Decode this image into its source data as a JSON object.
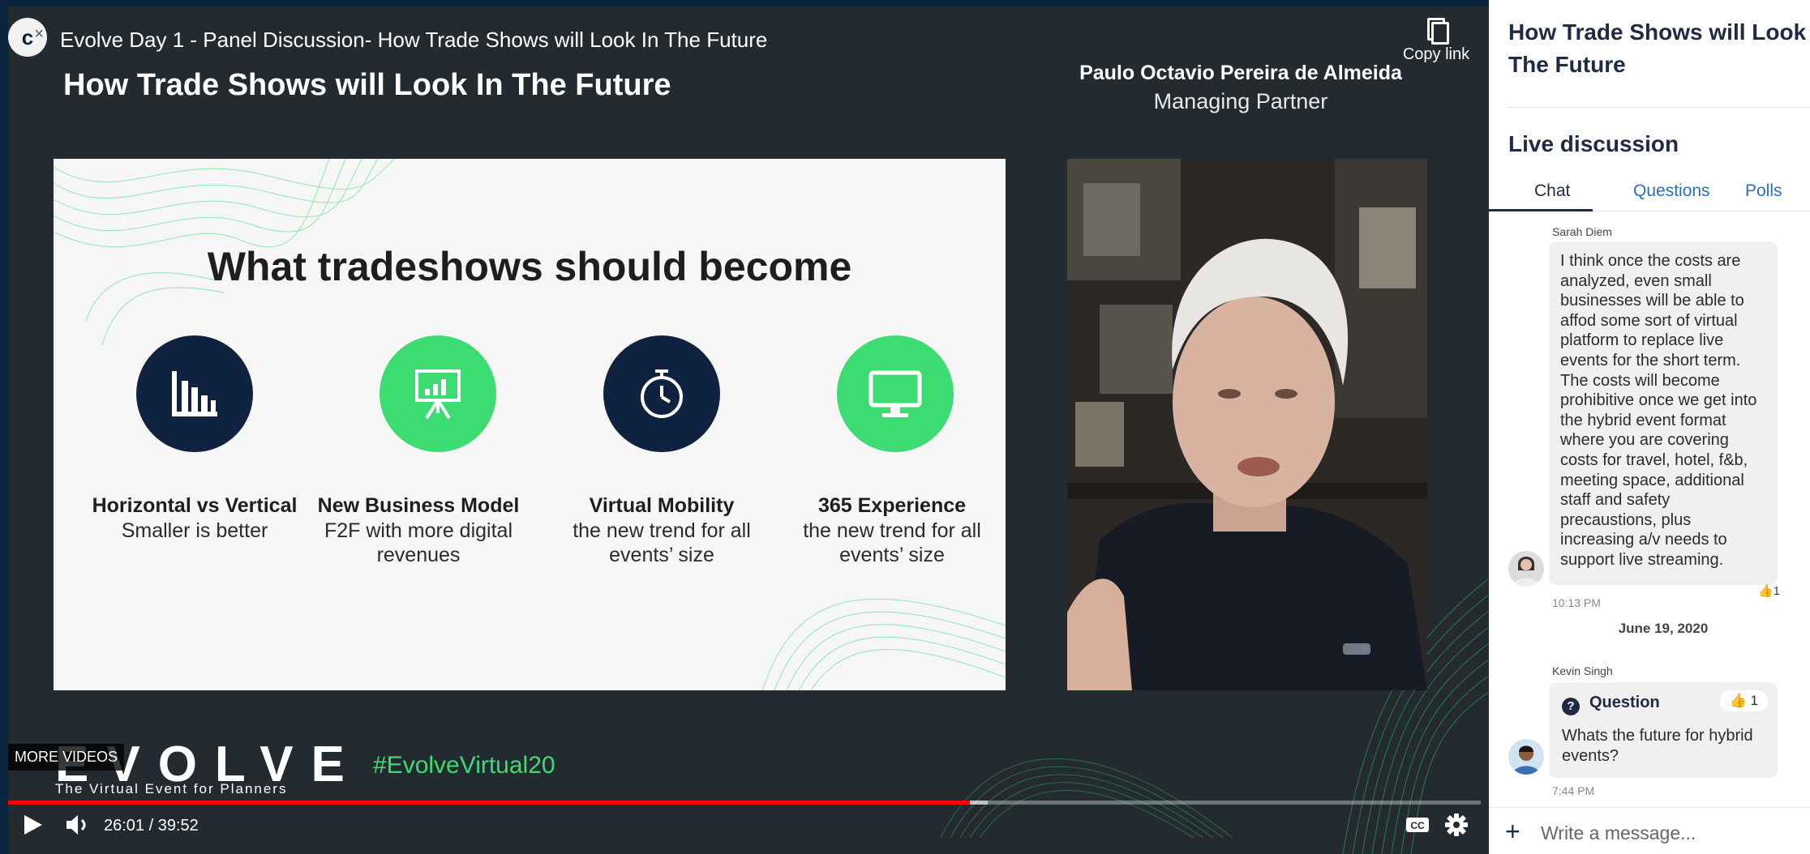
{
  "player": {
    "channel_initial": "c",
    "video_title": "Evolve Day 1 - Panel Discussion- How Trade Shows will Look In The Future",
    "copy_link": "Copy link",
    "slide_heading": "How Trade Shows will Look In The Future",
    "speaker_name": "Paulo Octavio Pereira de Almeida",
    "speaker_role": "Managing Partner",
    "slide": {
      "title": "What tradeshows should become",
      "features": [
        {
          "title": "Horizontal vs Vertical",
          "desc": "Smaller is better",
          "icon": "bar-chart-icon",
          "color": "#0f2340"
        },
        {
          "title": "New Business Model",
          "desc": "F2F with more digital revenues",
          "icon": "presentation-board-icon",
          "color": "#3ddc73"
        },
        {
          "title": "Virtual Mobility",
          "desc": "the new trend for all events’ size",
          "icon": "stopwatch-icon",
          "color": "#0f2340"
        },
        {
          "title": "365 Experience",
          "desc": "the new trend for all events’ size",
          "icon": "monitor-icon",
          "color": "#3ddc73"
        }
      ]
    },
    "logo_text": "EVOLVE",
    "logo_tagline": "The Virtual Event for Planners",
    "hashtag": "#EvolveVirtual20",
    "more_videos": "MORE VIDEOS",
    "time_display": "26:01 / 39:52",
    "progress_played": 0.653,
    "progress_loaded": 0.665
  },
  "panel": {
    "title": "How Trade Shows will Look In The Future",
    "live_heading": "Live discussion",
    "tabs": [
      "Chat",
      "Questions",
      "Polls"
    ],
    "active_tab": "Chat",
    "messages": [
      {
        "author": "Sarah Diem",
        "text": "I think once the costs are analyzed, even small businesses will be able to affod some sort of virtual platform to replace live events for the short term. The costs will become prohibitive once we get into the hybrid event format where you are covering costs for travel, hotel, f&b, meeting space, additional staff and safety precaustions, plus increasing a/v needs to support live streaming.",
        "reaction": "👍1",
        "time": "10:13 PM"
      },
      {
        "author": "Kevin Singh",
        "type_label": "Question",
        "likes": "1",
        "text": "Whats the future for hybrid events?",
        "time": "7:44 PM"
      }
    ],
    "date_divider": "June 19, 2020",
    "composer_placeholder": "Write a message..."
  }
}
